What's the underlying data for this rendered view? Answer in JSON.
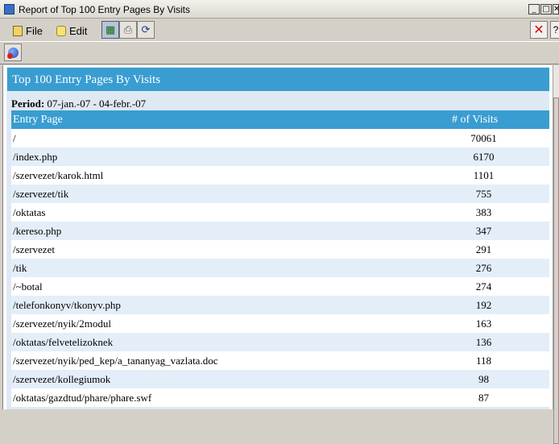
{
  "window": {
    "title": "Report of Top 100 Entry Pages By Visits",
    "controls": {
      "minimize": "_",
      "maximize": "□",
      "close": "✕"
    }
  },
  "menu": {
    "file": "File",
    "edit": "Edit",
    "close_glyph": "✕",
    "help_glyph": "?"
  },
  "report": {
    "title": "Top 100 Entry Pages By Visits",
    "period_label": "Period:",
    "period_value": "07-jan.-07 - 04-febr.-07",
    "columns": {
      "page": "Entry Page",
      "visits": "# of Visits"
    },
    "rows": [
      {
        "page": "/",
        "visits": "70061"
      },
      {
        "page": "/index.php",
        "visits": "6170"
      },
      {
        "page": "/szervezet/karok.html",
        "visits": "1101"
      },
      {
        "page": "/szervezet/tik",
        "visits": "755"
      },
      {
        "page": "/oktatas",
        "visits": "383"
      },
      {
        "page": "/kereso.php",
        "visits": "347"
      },
      {
        "page": "/szervezet",
        "visits": "291"
      },
      {
        "page": "/tik",
        "visits": "276"
      },
      {
        "page": "/~botal",
        "visits": "274"
      },
      {
        "page": "/telefonkonyv/tkonyv.php",
        "visits": "192"
      },
      {
        "page": "/szervezet/nyik/2modul",
        "visits": "163"
      },
      {
        "page": "/oktatas/felvetelizoknek",
        "visits": "136"
      },
      {
        "page": "/szervezet/nyik/ped_kep/a_tananyag_vazlata.doc",
        "visits": "118"
      },
      {
        "page": "/szervezet/kollegiumok",
        "visits": "98"
      },
      {
        "page": "/oktatas/gazdtud/phare/phare.swf",
        "visits": "87"
      }
    ]
  }
}
